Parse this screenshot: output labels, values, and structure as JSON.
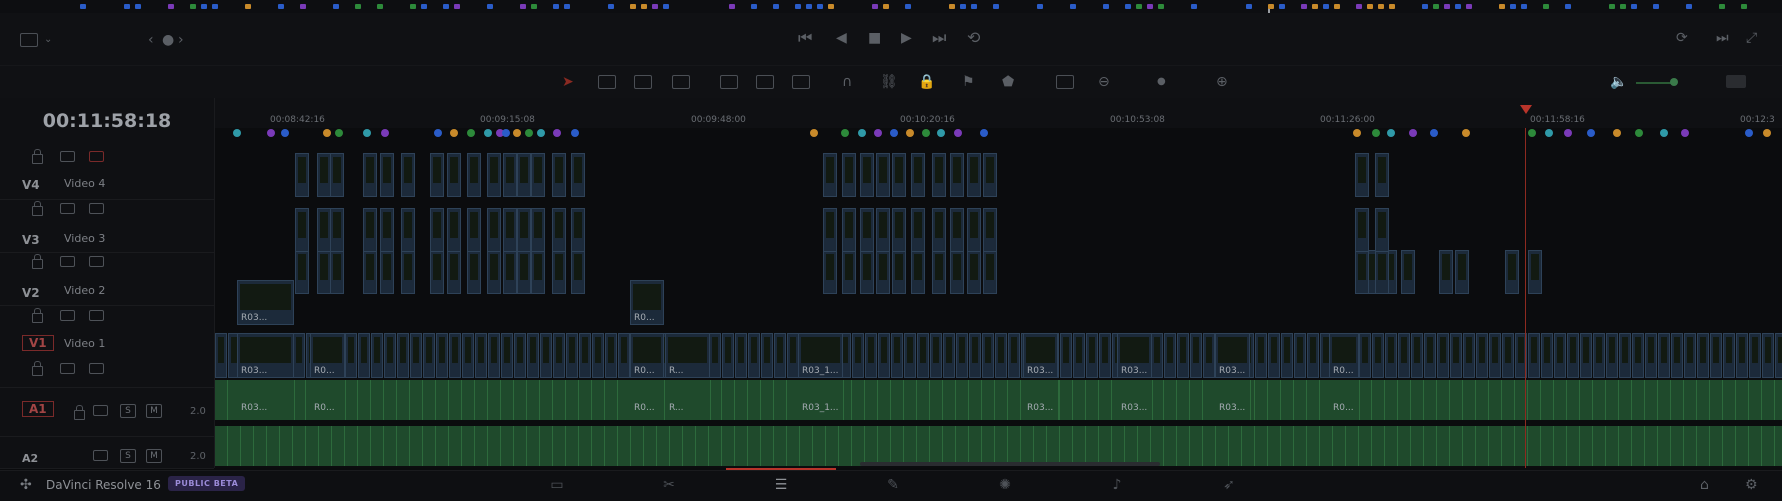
{
  "app": {
    "name": "DaVinci Resolve 16",
    "badge": "PUBLIC BETA"
  },
  "timecode": "00:11:58:18",
  "ruler": {
    "ticks": [
      "00:08:42:16",
      "00:09:15:08",
      "00:09:48:00",
      "00:10:20:16",
      "00:10:53:08",
      "00:11:26:00",
      "00:11:58:16",
      "00:12:3"
    ]
  },
  "tracks": [
    {
      "id": "V4",
      "name": "Video 4"
    },
    {
      "id": "V3",
      "name": "Video 3"
    },
    {
      "id": "V2",
      "name": "Video 2"
    },
    {
      "id": "V1",
      "name": "Video 1"
    },
    {
      "id": "A1",
      "name": "",
      "volume": "2.0",
      "solo": "S",
      "mute": "M"
    },
    {
      "id": "A2",
      "name": "",
      "volume": "2.0",
      "solo": "S",
      "mute": "M"
    }
  ],
  "clip_labels": {
    "v2a": "R03...",
    "v2b": "R0...",
    "v1a": "R03...",
    "v1b": "R0...",
    "v1c": "R0...",
    "v1d": "R...",
    "v1e": "R03_1...",
    "v1f": "R03...",
    "v1g": "R03...",
    "v1h": "R03...",
    "v1i": "R0...",
    "a1a": "R03...",
    "a1b": "R0...",
    "a1c": "R0...",
    "a1d": "R...",
    "a1e": "R03_1...",
    "a1f": "R03...",
    "a1g": "R03...",
    "a1h": "R03...",
    "a1i": "R0..."
  },
  "colors": {
    "accent_red": "#b8342a",
    "video_clip": "#1c2a3a",
    "audio_clip": "#1f4a2c",
    "beta_purple": "#9b8bd8"
  },
  "icons": {
    "pages": [
      "media-page-icon",
      "cut-page-icon",
      "edit-page-icon",
      "fusion-page-icon",
      "color-page-icon",
      "fairlight-page-icon",
      "deliver-page-icon"
    ]
  }
}
